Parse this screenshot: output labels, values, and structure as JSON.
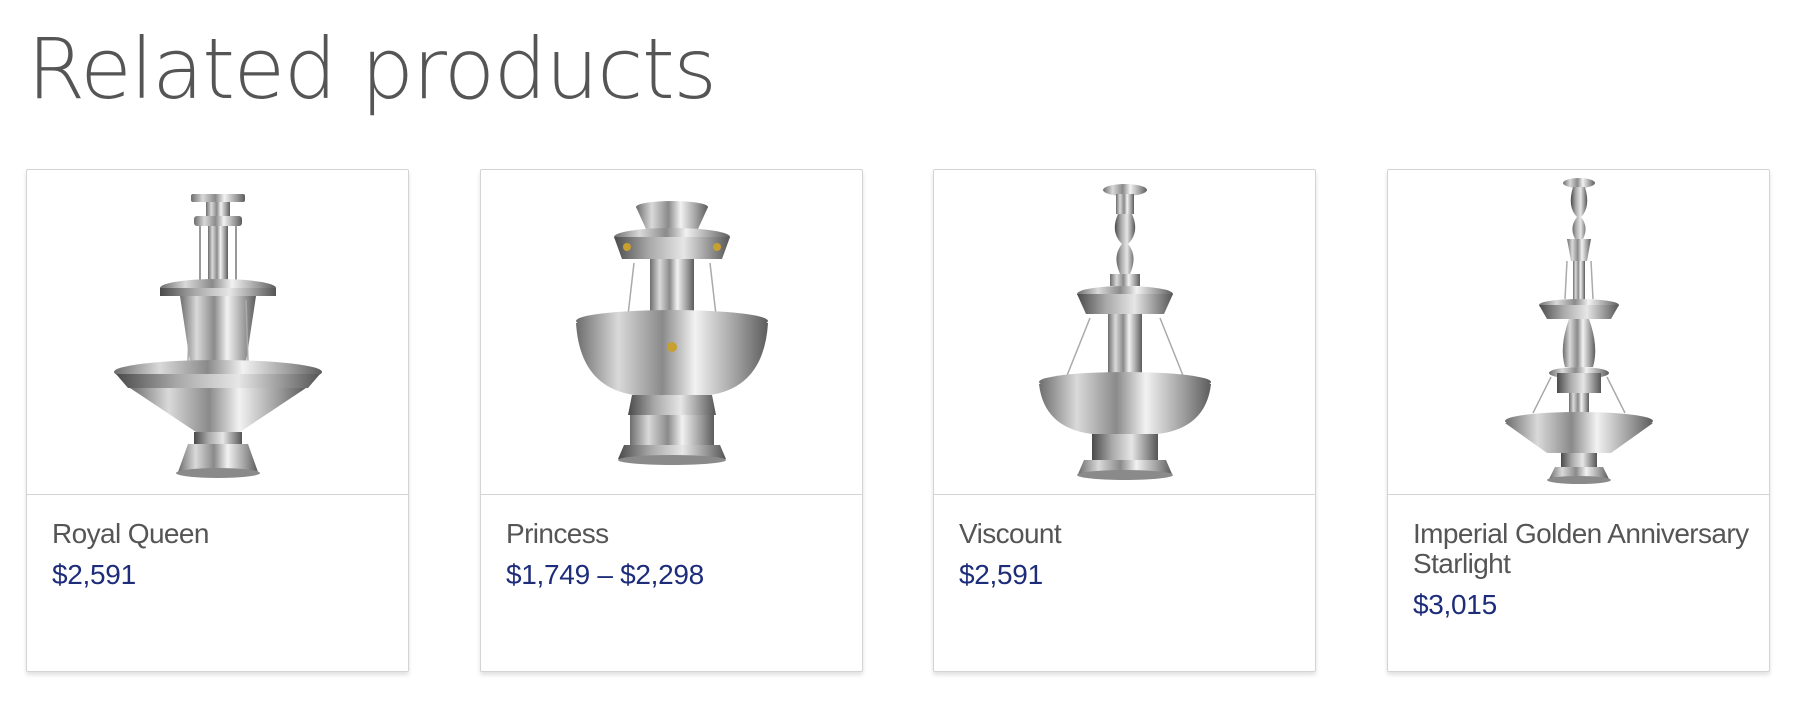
{
  "section": {
    "title": "Related products"
  },
  "products": [
    {
      "name": "Royal Queen",
      "price": "$2,591",
      "image_icon": "fountain-icon"
    },
    {
      "name": "Princess",
      "price": "$1,749 – $2,298",
      "image_icon": "fountain-icon"
    },
    {
      "name": "Viscount",
      "price": "$2,591",
      "image_icon": "fountain-icon"
    },
    {
      "name": "Imperial Golden Anniversary Starlight",
      "price": "$3,015",
      "image_icon": "fountain-icon"
    }
  ],
  "colors": {
    "price": "#1e2d7a",
    "text": "#555555",
    "border": "#d4d4d4"
  }
}
